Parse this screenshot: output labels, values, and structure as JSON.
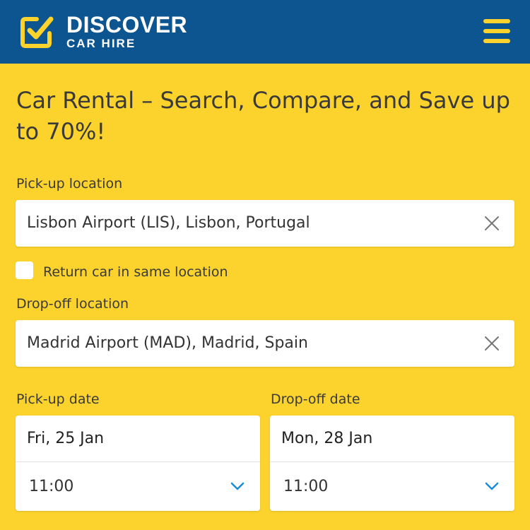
{
  "header": {
    "brand_line1": "DISCOVER",
    "brand_line2": "CAR HIRE",
    "colors": {
      "bar": "#0c5591",
      "accent": "#fcd22d"
    }
  },
  "page": {
    "title": "Car Rental – Search, Compare, and Save up to 70%!"
  },
  "form": {
    "pickup_label": "Pick-up location",
    "pickup_value": "Lisbon Airport (LIS), Lisbon, Portugal",
    "return_same_label": "Return car in same location",
    "return_same_checked": false,
    "dropoff_label": "Drop-off location",
    "dropoff_value": "Madrid Airport (MAD), Madrid, Spain",
    "pickup_date_label": "Pick-up date",
    "pickup_date": "Fri, 25 Jan",
    "pickup_time": "11:00",
    "dropoff_date_label": "Drop-off date",
    "dropoff_date": "Mon, 28 Jan",
    "dropoff_time": "11:00"
  },
  "icons": {
    "logo": "checkbox-logo-icon",
    "menu": "hamburger-menu-icon",
    "clear": "close-icon",
    "dropdown": "chevron-down-icon"
  }
}
